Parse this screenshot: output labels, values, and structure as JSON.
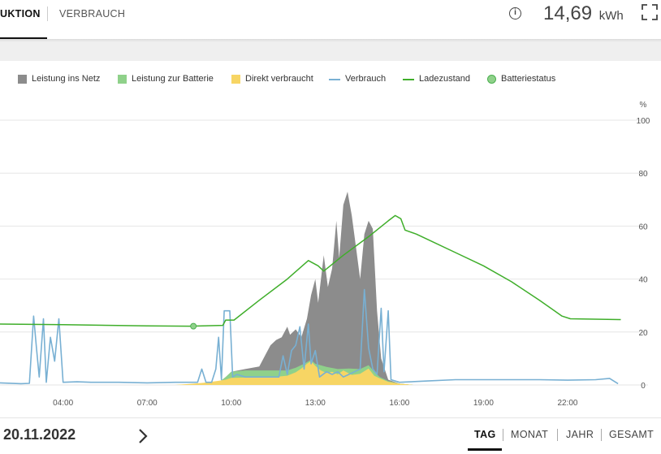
{
  "header": {
    "tabs": [
      {
        "label": "UKTION",
        "active": true
      },
      {
        "label": "VERBRAUCH",
        "active": false
      }
    ],
    "energy_value": "14,69",
    "energy_unit": "kWh"
  },
  "chart_data": {
    "type": "area",
    "legend": [
      {
        "label": "Leistung ins Netz",
        "kind": "area",
        "color": "#8c8c8c"
      },
      {
        "label": "Leistung zur Batterie",
        "kind": "area",
        "color": "#8fd18a"
      },
      {
        "label": "Direkt verbraucht",
        "kind": "area",
        "color": "#f7d564"
      },
      {
        "label": "Verbrauch",
        "kind": "line",
        "color": "#78b0d3"
      },
      {
        "label": "Ladezustand",
        "kind": "line",
        "color": "#3fae2a"
      },
      {
        "label": "Batteriestatus",
        "kind": "marker",
        "color": "#8fd18a"
      }
    ],
    "y_right_unit": "%",
    "y_right_ticks": [
      "100",
      "80",
      "60",
      "40",
      "20",
      "0"
    ],
    "ylim_right": [
      0,
      100
    ],
    "x_ticks": [
      "04:00",
      "07:00",
      "10:00",
      "13:00",
      "16:00",
      "19:00",
      "22:00"
    ],
    "x_hours": [
      4,
      7,
      10,
      13,
      16,
      19,
      22
    ],
    "xlim_hours": [
      1.75,
      24.0
    ],
    "direkt_verbraucht_kw": [
      [
        8.0,
        0
      ],
      [
        8.5,
        0.04
      ],
      [
        9.0,
        0.08
      ],
      [
        9.5,
        0.15
      ],
      [
        9.8,
        0.2
      ],
      [
        10.0,
        0.27
      ],
      [
        10.5,
        0.28
      ],
      [
        11.0,
        0.3
      ],
      [
        11.5,
        0.3
      ],
      [
        12.0,
        0.35
      ],
      [
        12.3,
        0.48
      ],
      [
        12.5,
        0.62
      ],
      [
        12.7,
        0.8
      ],
      [
        12.85,
        0.9
      ],
      [
        13.0,
        0.72
      ],
      [
        13.2,
        0.55
      ],
      [
        13.4,
        0.45
      ],
      [
        13.6,
        0.5
      ],
      [
        13.8,
        0.4
      ],
      [
        14.0,
        0.55
      ],
      [
        14.3,
        0.38
      ],
      [
        14.6,
        0.42
      ],
      [
        14.9,
        0.62
      ],
      [
        15.1,
        0.35
      ],
      [
        15.3,
        0.25
      ],
      [
        15.6,
        0.12
      ],
      [
        16.0,
        0.05
      ],
      [
        16.3,
        0.02
      ],
      [
        16.5,
        0
      ]
    ],
    "leistung_zur_batterie_kw": [
      [
        8.0,
        0
      ],
      [
        9.0,
        0.03
      ],
      [
        9.5,
        0.05
      ],
      [
        9.8,
        0.3
      ],
      [
        10.0,
        0.5
      ],
      [
        10.5,
        0.55
      ],
      [
        11.0,
        0.55
      ],
      [
        11.5,
        0.55
      ],
      [
        12.0,
        0.55
      ],
      [
        12.3,
        0.65
      ],
      [
        12.6,
        0.8
      ],
      [
        12.85,
        0.95
      ],
      [
        13.0,
        0.8
      ],
      [
        13.4,
        0.68
      ],
      [
        13.8,
        0.6
      ],
      [
        14.2,
        0.62
      ],
      [
        14.6,
        0.6
      ],
      [
        14.9,
        0.75
      ],
      [
        15.1,
        0.5
      ],
      [
        15.3,
        0.3
      ],
      [
        15.6,
        0.15
      ],
      [
        16.0,
        0.05
      ],
      [
        16.5,
        0
      ]
    ],
    "leistung_ins_netz_kw": [
      [
        9.5,
        0.05
      ],
      [
        9.8,
        0.3
      ],
      [
        10.0,
        0.5
      ],
      [
        10.5,
        0.6
      ],
      [
        11.0,
        0.7
      ],
      [
        11.2,
        1.1
      ],
      [
        11.4,
        1.5
      ],
      [
        11.6,
        1.7
      ],
      [
        11.8,
        1.8
      ],
      [
        12.0,
        2.2
      ],
      [
        12.1,
        1.9
      ],
      [
        12.3,
        2.1
      ],
      [
        12.5,
        1.8
      ],
      [
        12.7,
        2.5
      ],
      [
        12.85,
        3.4
      ],
      [
        13.0,
        4.0
      ],
      [
        13.1,
        3.1
      ],
      [
        13.3,
        4.9
      ],
      [
        13.45,
        3.7
      ],
      [
        13.6,
        4.4
      ],
      [
        13.75,
        6.2
      ],
      [
        13.85,
        4.8
      ],
      [
        14.0,
        6.8
      ],
      [
        14.15,
        7.3
      ],
      [
        14.3,
        6.4
      ],
      [
        14.45,
        5.2
      ],
      [
        14.6,
        4.0
      ],
      [
        14.75,
        5.7
      ],
      [
        14.9,
        6.2
      ],
      [
        15.05,
        5.9
      ],
      [
        15.2,
        2.8
      ],
      [
        15.35,
        1.0
      ],
      [
        15.6,
        0.2
      ],
      [
        16.0,
        0.05
      ],
      [
        16.5,
        0
      ]
    ],
    "verbrauch_kw": [
      [
        1.75,
        0.08
      ],
      [
        2.5,
        0.05
      ],
      [
        2.8,
        0.06
      ],
      [
        2.95,
        2.6
      ],
      [
        3.05,
        1.4
      ],
      [
        3.15,
        0.3
      ],
      [
        3.3,
        2.5
      ],
      [
        3.4,
        0.1
      ],
      [
        3.55,
        1.8
      ],
      [
        3.7,
        0.9
      ],
      [
        3.85,
        2.5
      ],
      [
        4.0,
        0.1
      ],
      [
        4.5,
        0.12
      ],
      [
        5.0,
        0.1
      ],
      [
        6.0,
        0.1
      ],
      [
        7.0,
        0.08
      ],
      [
        8.0,
        0.1
      ],
      [
        8.8,
        0.1
      ],
      [
        8.95,
        0.6
      ],
      [
        9.1,
        0.1
      ],
      [
        9.3,
        0.1
      ],
      [
        9.45,
        0.6
      ],
      [
        9.55,
        1.8
      ],
      [
        9.65,
        0.2
      ],
      [
        9.75,
        2.8
      ],
      [
        9.95,
        2.8
      ],
      [
        10.05,
        0.3
      ],
      [
        10.2,
        0.4
      ],
      [
        10.5,
        0.3
      ],
      [
        11.0,
        0.3
      ],
      [
        11.5,
        0.3
      ],
      [
        11.7,
        0.3
      ],
      [
        11.85,
        1.1
      ],
      [
        12.0,
        0.4
      ],
      [
        12.15,
        1.3
      ],
      [
        12.3,
        1.5
      ],
      [
        12.45,
        2.2
      ],
      [
        12.6,
        0.6
      ],
      [
        12.75,
        2.3
      ],
      [
        12.85,
        0.8
      ],
      [
        13.0,
        1.3
      ],
      [
        13.15,
        0.3
      ],
      [
        13.4,
        0.5
      ],
      [
        13.6,
        0.4
      ],
      [
        13.8,
        0.5
      ],
      [
        14.0,
        0.3
      ],
      [
        14.2,
        0.4
      ],
      [
        14.4,
        0.5
      ],
      [
        14.6,
        0.6
      ],
      [
        14.75,
        3.6
      ],
      [
        14.9,
        1.4
      ],
      [
        15.05,
        0.6
      ],
      [
        15.2,
        0.4
      ],
      [
        15.35,
        2.9
      ],
      [
        15.45,
        0.5
      ],
      [
        15.6,
        2.8
      ],
      [
        15.7,
        0.2
      ],
      [
        16.0,
        0.1
      ],
      [
        17.0,
        0.15
      ],
      [
        18.0,
        0.2
      ],
      [
        19.0,
        0.2
      ],
      [
        20.0,
        0.2
      ],
      [
        21.0,
        0.2
      ],
      [
        22.0,
        0.18
      ],
      [
        23.0,
        0.2
      ],
      [
        23.5,
        0.25
      ],
      [
        23.8,
        0.05
      ]
    ],
    "ladezustand_pct": [
      [
        1.75,
        23
      ],
      [
        4.0,
        22.8
      ],
      [
        7.0,
        22.3
      ],
      [
        8.5,
        22.2
      ],
      [
        9.7,
        22.5
      ],
      [
        9.8,
        24.5
      ],
      [
        10.1,
        24.5
      ],
      [
        11.0,
        32
      ],
      [
        12.0,
        40
      ],
      [
        12.75,
        47
      ],
      [
        13.1,
        45
      ],
      [
        13.3,
        43
      ],
      [
        14.0,
        49
      ],
      [
        14.9,
        56
      ],
      [
        15.6,
        62
      ],
      [
        15.85,
        64
      ],
      [
        16.05,
        62.8
      ],
      [
        16.2,
        58.5
      ],
      [
        16.6,
        57
      ],
      [
        17.0,
        55
      ],
      [
        18.0,
        50
      ],
      [
        19.0,
        45
      ],
      [
        20.0,
        39
      ],
      [
        21.0,
        32
      ],
      [
        21.8,
        26
      ],
      [
        22.1,
        25
      ],
      [
        23.9,
        24.7
      ]
    ],
    "batteriestatus_marker": {
      "hour": 8.65,
      "pct": 22.2
    }
  },
  "footer": {
    "date": "20.11.2022",
    "periods": [
      "TAG",
      "MONAT",
      "JAHR",
      "GESAMT"
    ],
    "active_period": "TAG"
  },
  "icons": [
    "info-icon",
    "fullscreen-icon",
    "chevron-right-icon"
  ]
}
